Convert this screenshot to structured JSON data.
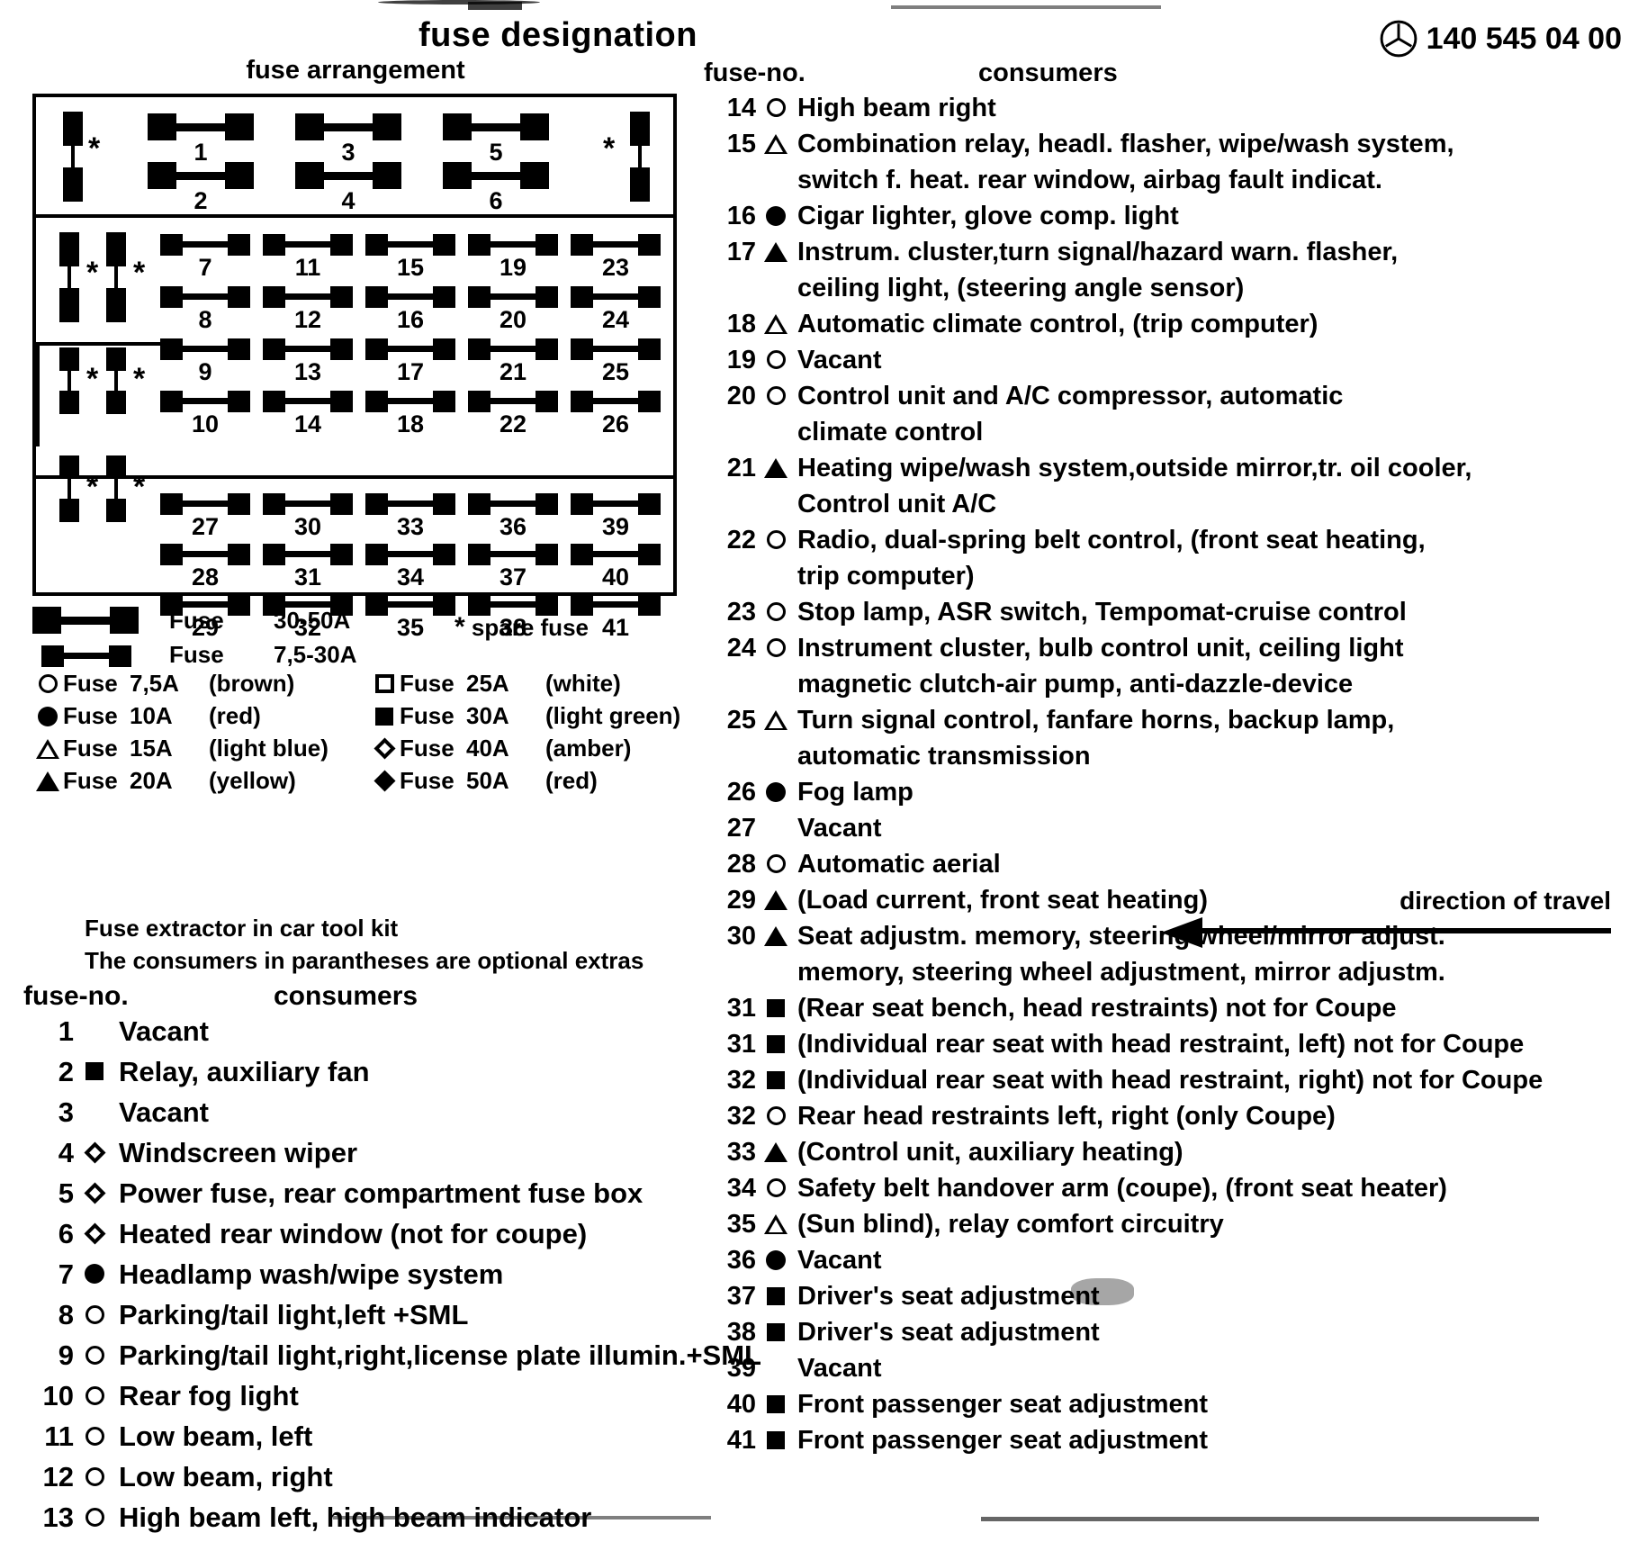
{
  "title": "fuse designation",
  "part_number": "140 545 04 00",
  "brand_icon": "mercedes-star-icon",
  "arrangement_title": "fuse arrangement",
  "headings": {
    "fuse_no": "fuse-no.",
    "consumers": "consumers"
  },
  "arrangement": {
    "group1": [
      "1",
      "2",
      "3",
      "4",
      "5",
      "6"
    ],
    "group2": [
      "7",
      "8",
      "9",
      "10",
      "11",
      "12",
      "13",
      "14",
      "15",
      "16",
      "17",
      "18",
      "19",
      "20",
      "21",
      "22",
      "23",
      "24",
      "25",
      "26"
    ],
    "group3": [
      "27",
      "28",
      "29",
      "30",
      "31",
      "32",
      "33",
      "34",
      "35",
      "36",
      "37",
      "38",
      "39",
      "40",
      "41"
    ],
    "spare_marker": "*"
  },
  "wire_legend": [
    {
      "type": "big",
      "label": "Fuse",
      "rating": "30-50A"
    },
    {
      "type": "small",
      "label": "Fuse",
      "rating": "7,5-30A"
    }
  ],
  "spare_legend": {
    "marker": "*",
    "text": "spare fuse"
  },
  "symbol_legend_left": [
    {
      "symbol": "circle-outline",
      "label": "Fuse",
      "rating": "7,5A",
      "color": "(brown)"
    },
    {
      "symbol": "circle-filled",
      "label": "Fuse",
      "rating": "10A",
      "color": "(red)"
    },
    {
      "symbol": "triangle-outline",
      "label": "Fuse",
      "rating": "15A",
      "color": "(light blue)"
    },
    {
      "symbol": "triangle-filled",
      "label": "Fuse",
      "rating": "20A",
      "color": "(yellow)"
    }
  ],
  "symbol_legend_right": [
    {
      "symbol": "square-outline",
      "label": "Fuse",
      "rating": "25A",
      "color": "(white)"
    },
    {
      "symbol": "square-filled",
      "label": "Fuse",
      "rating": "30A",
      "color": "(light green)"
    },
    {
      "symbol": "diamond-outline",
      "label": "Fuse",
      "rating": "40A",
      "color": "(amber)"
    },
    {
      "symbol": "diamond-filled",
      "label": "Fuse",
      "rating": "50A",
      "color": "(red)"
    }
  ],
  "notes": [
    "Fuse extractor in car tool kit",
    "The consumers in parantheses are optional extras"
  ],
  "direction_of_travel": "direction of travel",
  "fuses_left": [
    {
      "no": "1",
      "symbol": "none",
      "text": "Vacant"
    },
    {
      "no": "2",
      "symbol": "square-filled",
      "text": "Relay, auxiliary fan"
    },
    {
      "no": "3",
      "symbol": "none",
      "text": "Vacant"
    },
    {
      "no": "4",
      "symbol": "diamond-outline",
      "text": "Windscreen wiper"
    },
    {
      "no": "5",
      "symbol": "diamond-outline",
      "text": "Power fuse, rear compartment fuse box"
    },
    {
      "no": "6",
      "symbol": "diamond-outline",
      "text": "Heated rear window (not for coupe)"
    },
    {
      "no": "7",
      "symbol": "circle-filled",
      "text": "Headlamp wash/wipe system"
    },
    {
      "no": "8",
      "symbol": "circle-outline",
      "text": "Parking/tail light,left +SML"
    },
    {
      "no": "9",
      "symbol": "circle-outline",
      "text": "Parking/tail light,right,license plate illumin.+SML"
    },
    {
      "no": "10",
      "symbol": "circle-outline",
      "text": "Rear fog light"
    },
    {
      "no": "11",
      "symbol": "circle-outline",
      "text": "Low beam, left"
    },
    {
      "no": "12",
      "symbol": "circle-outline",
      "text": "Low beam, right"
    },
    {
      "no": "13",
      "symbol": "circle-outline",
      "text": "High beam left, high beam indicator"
    }
  ],
  "fuses_right": [
    {
      "no": "14",
      "symbol": "circle-outline",
      "text": "High beam right"
    },
    {
      "no": "15",
      "symbol": "triangle-outline",
      "text": "Combination relay, headl. flasher, wipe/wash system,",
      "cont": "switch f. heat. rear window, airbag fault indicat."
    },
    {
      "no": "16",
      "symbol": "circle-filled",
      "text": "Cigar lighter, glove comp. light"
    },
    {
      "no": "17",
      "symbol": "triangle-filled",
      "text": "Instrum. cluster,turn signal/hazard warn. flasher,",
      "cont": "ceiling light, (steering angle sensor)"
    },
    {
      "no": "18",
      "symbol": "triangle-outline",
      "text": "Automatic climate control, (trip computer)"
    },
    {
      "no": "19",
      "symbol": "circle-outline",
      "text": "Vacant"
    },
    {
      "no": "20",
      "symbol": "circle-outline",
      "text": "Control unit and A/C compressor, automatic",
      "cont": "climate control"
    },
    {
      "no": "21",
      "symbol": "triangle-filled",
      "text": "Heating wipe/wash system,outside mirror,tr. oil cooler,",
      "cont": "Control unit A/C"
    },
    {
      "no": "22",
      "symbol": "circle-outline",
      "text": "Radio, dual-spring belt control, (front seat heating,",
      "cont": "trip computer)"
    },
    {
      "no": "23",
      "symbol": "circle-outline",
      "text": "Stop lamp, ASR switch, Tempomat-cruise control"
    },
    {
      "no": "24",
      "symbol": "circle-outline",
      "text": "Instrument cluster, bulb control unit, ceiling light",
      "cont": "magnetic clutch-air pump, anti-dazzle-device"
    },
    {
      "no": "25",
      "symbol": "triangle-outline",
      "text": "Turn signal control, fanfare horns, backup lamp,",
      "cont": "automatic transmission"
    },
    {
      "no": "26",
      "symbol": "circle-filled",
      "text": "Fog lamp"
    },
    {
      "no": "27",
      "symbol": "none",
      "text": "Vacant"
    },
    {
      "no": "28",
      "symbol": "circle-outline",
      "text": "Automatic aerial"
    },
    {
      "no": "29",
      "symbol": "triangle-filled",
      "text": "(Load current, front seat heating)"
    },
    {
      "no": "30",
      "symbol": "triangle-filled",
      "text": "Seat adjustm. memory, steering wheel/mirror adjust.",
      "cont": "memory, steering wheel adjustment, mirror adjustm."
    },
    {
      "no": "31",
      "symbol": "square-filled",
      "text": "(Rear seat bench, head restraints) not for Coupe"
    },
    {
      "no": "31",
      "symbol": "square-filled",
      "text": "(Individual rear seat with head restraint, left) not for Coupe"
    },
    {
      "no": "32",
      "symbol": "square-filled",
      "text": "(Individual rear seat with head restraint, right) not for Coupe"
    },
    {
      "no": "32",
      "symbol": "circle-outline",
      "text": "Rear head restraints left, right (only Coupe)"
    },
    {
      "no": "33",
      "symbol": "triangle-filled",
      "text": "(Control unit, auxiliary heating)"
    },
    {
      "no": "34",
      "symbol": "circle-outline",
      "text": "Safety belt handover arm (coupe), (front seat heater)"
    },
    {
      "no": "35",
      "symbol": "triangle-outline",
      "text": "(Sun blind), relay comfort circuitry"
    },
    {
      "no": "36",
      "symbol": "circle-filled",
      "text": "Vacant"
    },
    {
      "no": "37",
      "symbol": "square-filled",
      "text": "Driver's seat adjustment"
    },
    {
      "no": "38",
      "symbol": "square-filled",
      "text": "Driver's seat adjustment"
    },
    {
      "no": "39",
      "symbol": "none",
      "text": "Vacant"
    },
    {
      "no": "40",
      "symbol": "square-filled",
      "text": "Front passenger seat adjustment"
    },
    {
      "no": "41",
      "symbol": "square-filled",
      "text": "Front passenger seat adjustment"
    }
  ]
}
